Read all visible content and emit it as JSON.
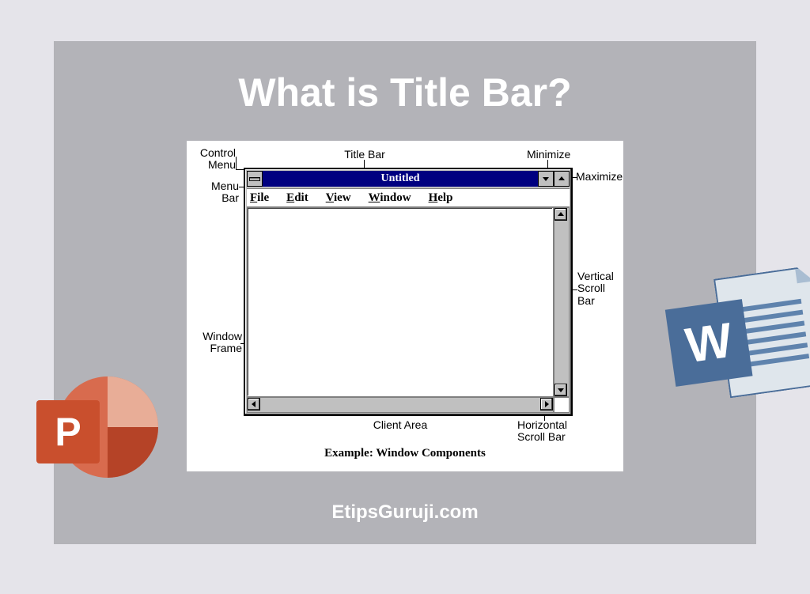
{
  "page": {
    "headline": "What is Title Bar?",
    "footline": "EtipsGuruji.com"
  },
  "labels": {
    "control_menu": "Control\nMenu",
    "title_bar": "Title Bar",
    "minimize": "Minimize",
    "maximize": "Maximize",
    "menu_bar": "Menu\nBar",
    "vertical_scroll": "Vertical\nScroll\nBar",
    "window_frame": "Window\nFrame",
    "client_area": "Client Area",
    "horizontal_scroll": "Horizontal\nScroll Bar"
  },
  "window": {
    "title": "Untitled",
    "menus": [
      "File",
      "Edit",
      "View",
      "Window",
      "Help"
    ]
  },
  "caption_lead": "Example:  ",
  "caption_body": "Window Components",
  "icons": {
    "powerpoint_letter": "P",
    "word_letter": "W"
  }
}
